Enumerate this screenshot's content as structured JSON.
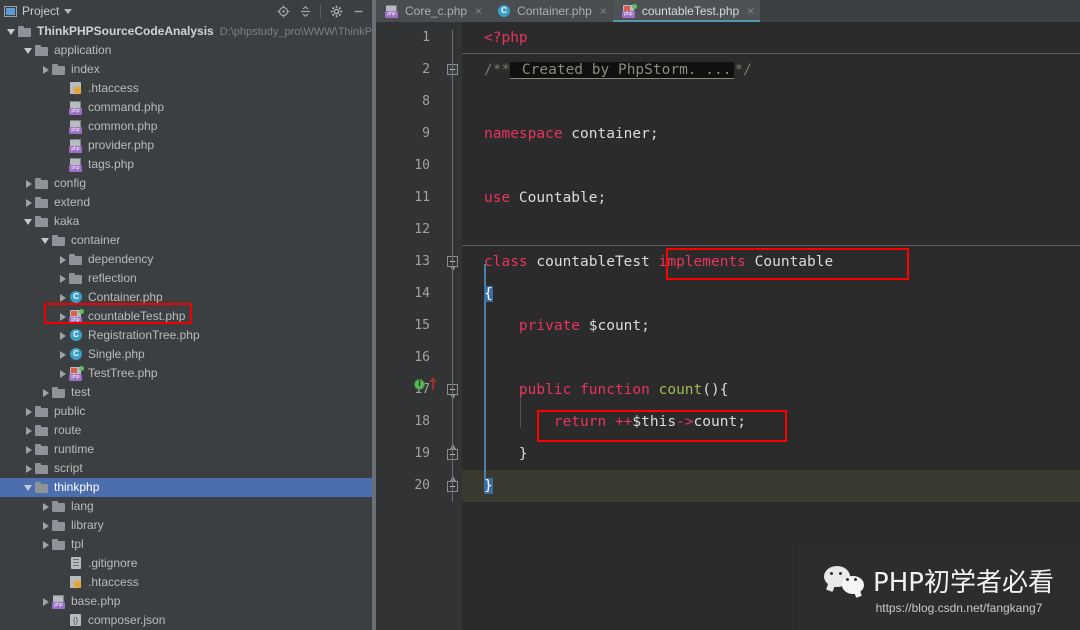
{
  "sidebar": {
    "toolbar": {
      "title": "Project",
      "icons": [
        "locate-icon",
        "collapse-all-icon",
        "gear-icon",
        "minimize-icon"
      ]
    },
    "tree": [
      {
        "label": "ThinkPHPSourceCodeAnalysis",
        "path": "D:\\phpstudy_pro\\WWW\\ThinkPHF",
        "depth": 0,
        "arrow": "down",
        "icon": "folder-icon",
        "bold": true
      },
      {
        "label": "application",
        "depth": 1,
        "arrow": "down",
        "icon": "folder-icon"
      },
      {
        "label": "index",
        "depth": 2,
        "arrow": "right",
        "icon": "folder-icon"
      },
      {
        "label": ".htaccess",
        "depth": 3,
        "arrow": "none",
        "icon": "htaccess-file-icon"
      },
      {
        "label": "command.php",
        "depth": 3,
        "arrow": "none",
        "icon": "php-file-icon"
      },
      {
        "label": "common.php",
        "depth": 3,
        "arrow": "none",
        "icon": "php-file-icon"
      },
      {
        "label": "provider.php",
        "depth": 3,
        "arrow": "none",
        "icon": "php-file-icon"
      },
      {
        "label": "tags.php",
        "depth": 3,
        "arrow": "none",
        "icon": "php-file-icon"
      },
      {
        "label": "config",
        "depth": 1,
        "arrow": "right",
        "icon": "folder-icon"
      },
      {
        "label": "extend",
        "depth": 1,
        "arrow": "right",
        "icon": "folder-icon"
      },
      {
        "label": "kaka",
        "depth": 1,
        "arrow": "down",
        "icon": "folder-icon"
      },
      {
        "label": "container",
        "depth": 2,
        "arrow": "down",
        "icon": "folder-icon"
      },
      {
        "label": "dependency",
        "depth": 3,
        "arrow": "right",
        "icon": "folder-icon"
      },
      {
        "label": "reflection",
        "depth": 3,
        "arrow": "right",
        "icon": "folder-icon"
      },
      {
        "label": "Container.php",
        "depth": 3,
        "arrow": "right",
        "icon": "php-class-icon"
      },
      {
        "label": "countableTest.php",
        "depth": 3,
        "arrow": "right",
        "icon": "php-interface-file-icon",
        "highlighted": true
      },
      {
        "label": "RegistrationTree.php",
        "depth": 3,
        "arrow": "right",
        "icon": "php-class-icon"
      },
      {
        "label": "Single.php",
        "depth": 3,
        "arrow": "right",
        "icon": "php-class-icon"
      },
      {
        "label": "TestTree.php",
        "depth": 3,
        "arrow": "right",
        "icon": "php-interface-file-icon"
      },
      {
        "label": "test",
        "depth": 2,
        "arrow": "right",
        "icon": "folder-icon"
      },
      {
        "label": "public",
        "depth": 1,
        "arrow": "right",
        "icon": "folder-icon"
      },
      {
        "label": "route",
        "depth": 1,
        "arrow": "right",
        "icon": "folder-icon"
      },
      {
        "label": "runtime",
        "depth": 1,
        "arrow": "right",
        "icon": "folder-icon"
      },
      {
        "label": "script",
        "depth": 1,
        "arrow": "right",
        "icon": "folder-icon"
      },
      {
        "label": "thinkphp",
        "depth": 1,
        "arrow": "down",
        "icon": "folder-icon",
        "selected": true
      },
      {
        "label": "lang",
        "depth": 2,
        "arrow": "right",
        "icon": "folder-icon"
      },
      {
        "label": "library",
        "depth": 2,
        "arrow": "right",
        "icon": "folder-icon"
      },
      {
        "label": "tpl",
        "depth": 2,
        "arrow": "right",
        "icon": "folder-icon"
      },
      {
        "label": ".gitignore",
        "depth": 3,
        "arrow": "none",
        "icon": "text-file-icon"
      },
      {
        "label": ".htaccess",
        "depth": 3,
        "arrow": "none",
        "icon": "htaccess-file-icon"
      },
      {
        "label": "base.php",
        "depth": 2,
        "arrow": "right",
        "icon": "php-file-icon"
      },
      {
        "label": "composer.json",
        "depth": 3,
        "arrow": "none",
        "icon": "json-file-icon"
      }
    ]
  },
  "editor": {
    "tabs": [
      {
        "label": "Core_c.php",
        "icon": "php-file-icon",
        "active": false,
        "close": "×"
      },
      {
        "label": "Container.php",
        "icon": "php-class-icon",
        "active": false,
        "close": "×"
      },
      {
        "label": "countableTest.php",
        "icon": "php-interface-file-icon",
        "active": true,
        "close": "×"
      }
    ],
    "line_numbers": [
      "1",
      "2",
      "8",
      "9",
      "10",
      "11",
      "12",
      "13",
      "14",
      "15",
      "16",
      "17",
      "18",
      "19",
      "20"
    ],
    "lines": [
      {
        "n": "1",
        "tokens": [
          {
            "t": "<?php",
            "c": "kw"
          }
        ]
      },
      {
        "n": "2",
        "tokens": [
          {
            "t": "/**",
            "c": "cm"
          },
          {
            "t": " Created by PhpStorm. ...",
            "c": "folded"
          },
          {
            "t": "*/",
            "c": "cm"
          }
        ]
      },
      {
        "n": "8",
        "tokens": []
      },
      {
        "n": "9",
        "tokens": [
          {
            "t": "namespace",
            "c": "kw"
          },
          {
            "t": " container;",
            "c": "pl"
          }
        ]
      },
      {
        "n": "10",
        "tokens": []
      },
      {
        "n": "11",
        "tokens": [
          {
            "t": "use",
            "c": "kw"
          },
          {
            "t": " Countable;",
            "c": "pl"
          }
        ]
      },
      {
        "n": "12",
        "tokens": []
      },
      {
        "n": "13",
        "tokens": [
          {
            "t": "class",
            "c": "kw"
          },
          {
            "t": " countableTest ",
            "c": "pl"
          },
          {
            "t": "implements",
            "c": "kw"
          },
          {
            "t": " Countable",
            "c": "pl"
          }
        ]
      },
      {
        "n": "14",
        "tokens": [
          {
            "t": "{",
            "c": "brace"
          }
        ]
      },
      {
        "n": "15",
        "tokens": [
          {
            "t": "    private",
            "c": "kw"
          },
          {
            "t": " $count;",
            "c": "pl"
          }
        ]
      },
      {
        "n": "16",
        "tokens": []
      },
      {
        "n": "17",
        "tokens": [
          {
            "t": "    public function",
            "c": "kw"
          },
          {
            "t": " ",
            "c": "pl"
          },
          {
            "t": "count",
            "c": "fn"
          },
          {
            "t": "(){",
            "c": "pl"
          }
        ]
      },
      {
        "n": "18",
        "tokens": [
          {
            "t": "        return",
            "c": "kw"
          },
          {
            "t": " ",
            "c": "pl"
          },
          {
            "t": "++",
            "c": "kw"
          },
          {
            "t": "$this",
            "c": "pl"
          },
          {
            "t": "->",
            "c": "kw"
          },
          {
            "t": "count;",
            "c": "pl"
          }
        ]
      },
      {
        "n": "19",
        "tokens": [
          {
            "t": "    }",
            "c": "pl"
          }
        ]
      },
      {
        "n": "20",
        "tokens": [
          {
            "t": "}",
            "c": "brace"
          }
        ]
      }
    ],
    "gutter_markers": {
      "line17": [
        "implementing-method-icon",
        "overriding-method-icon"
      ]
    },
    "annotations": [
      {
        "name": "implements-countable-highlight"
      },
      {
        "name": "return-count-highlight"
      }
    ]
  },
  "watermark": {
    "brand": "PHP初学者必看",
    "url": "https://blog.csdn.net/fangkang7",
    "icon": "wechat-icon"
  },
  "colors": {
    "sidebar_bg": "#3c3f41",
    "editor_bg": "#2b2b2b",
    "gutter_bg": "#313335",
    "selection_blue": "#4b6eaf",
    "keyword_red": "#e8355e",
    "highlight_red": "#ff0000",
    "tab_accent": "#4e9aa8",
    "function_green": "#9fbb54"
  }
}
